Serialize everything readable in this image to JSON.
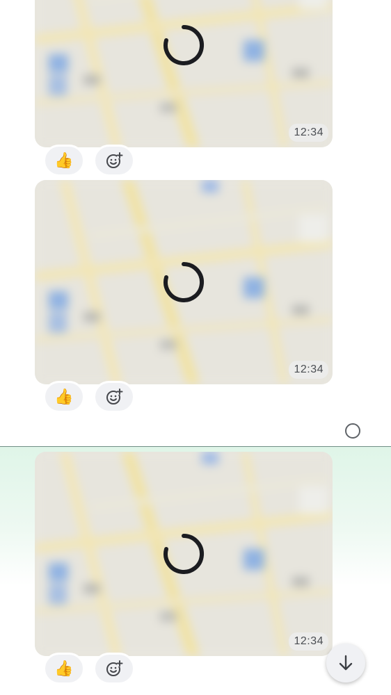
{
  "messages": [
    {
      "kind": "location",
      "time": "12:34",
      "reaction": "👍",
      "loading": true
    },
    {
      "kind": "location",
      "time": "12:34",
      "reaction": "👍",
      "loading": true
    },
    {
      "kind": "location",
      "time": "12:34",
      "reaction": "👍",
      "loading": true
    }
  ],
  "icons": {
    "reaction": "thumbs-up-emoji",
    "add_reaction": "smiley-plus-icon",
    "loading": "spinner-icon",
    "read_status": "circle-status-icon",
    "scroll_down": "arrow-down-icon"
  },
  "colors": {
    "new_messages_tint": "#dff5e8",
    "divider": "#6f8e85",
    "reaction_pill": "#f0f1f4"
  }
}
